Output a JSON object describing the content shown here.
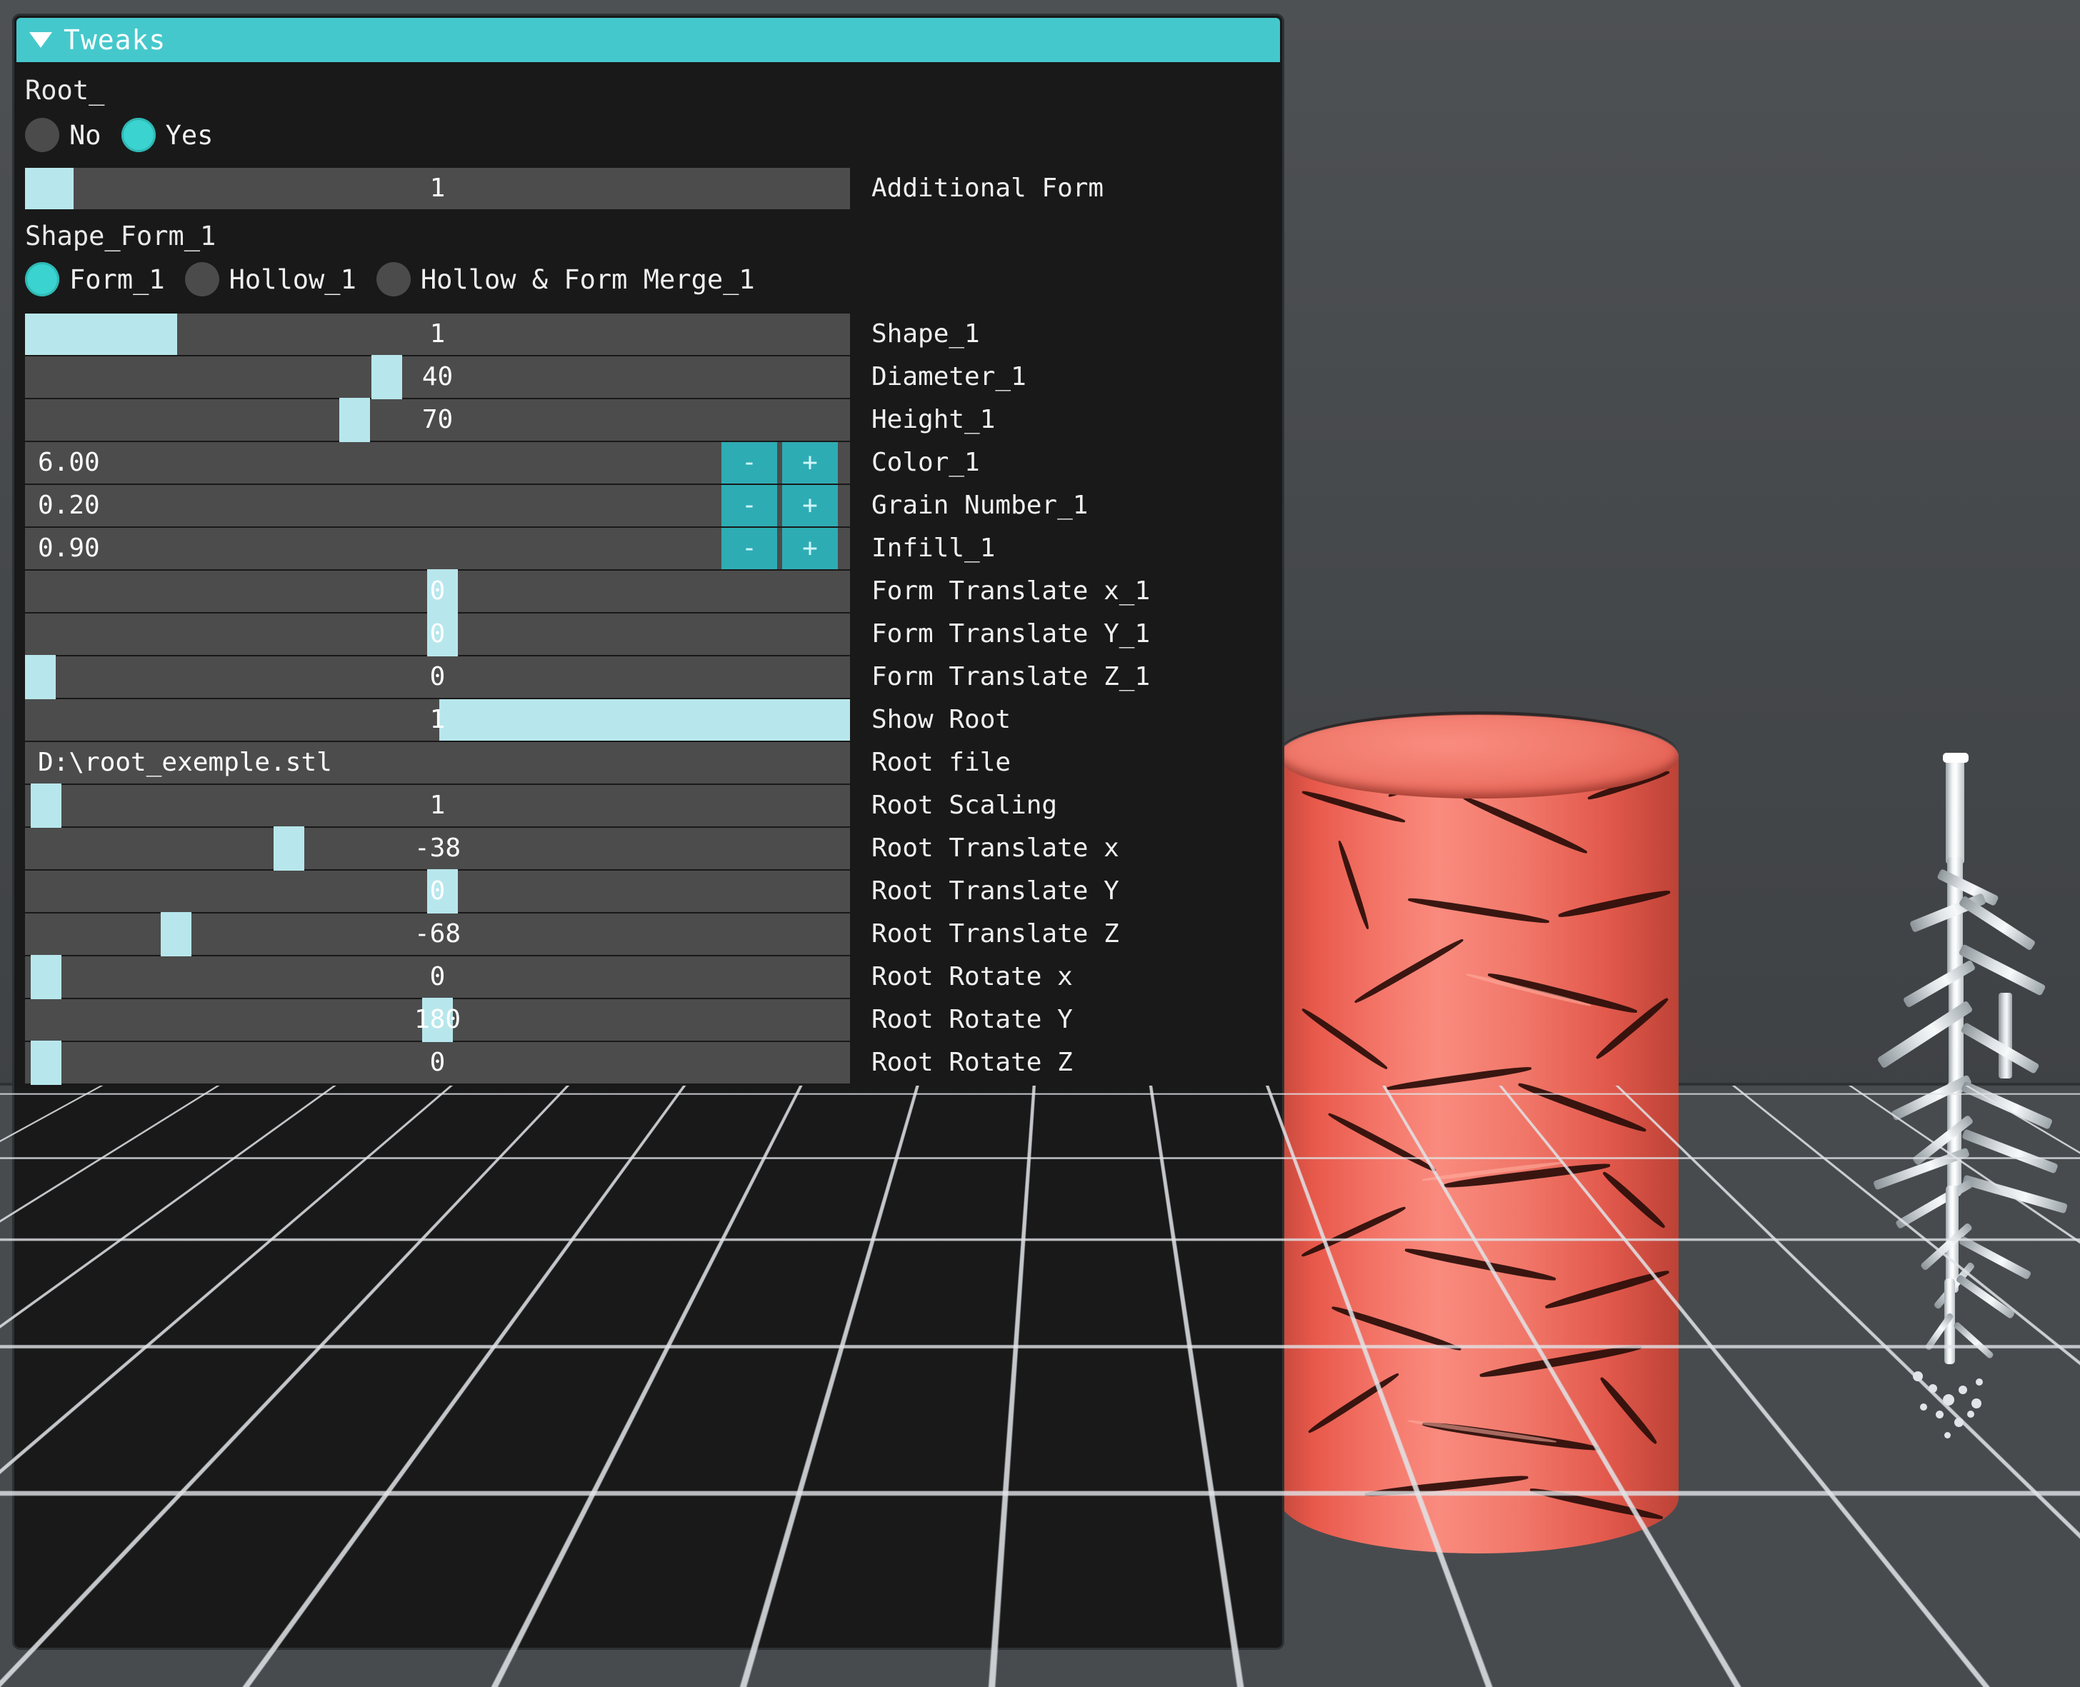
{
  "panel": {
    "title": "Tweaks",
    "collapse_icon": "triangle-down-icon",
    "groups": [
      {
        "label": "Root_"
      },
      {
        "label": "Shape_Form_1"
      }
    ],
    "root_radios": [
      {
        "label": "No",
        "selected": false
      },
      {
        "label": "Yes",
        "selected": true
      }
    ],
    "shape_form_radios": [
      {
        "label": "Form_1",
        "selected": true
      },
      {
        "label": "Hollow_1",
        "selected": false
      },
      {
        "label": "Hollow & Form Merge_1",
        "selected": false
      }
    ],
    "rows": [
      {
        "label": "Additional Form",
        "value": "1",
        "kind": "fill",
        "fill_from": 0,
        "fill_to": 68
      },
      {
        "label": "Shape_1",
        "value": "1",
        "kind": "fill",
        "fill_from": 0,
        "fill_to": 213
      },
      {
        "label": "Diameter_1",
        "value": "40",
        "kind": "handle",
        "handle_at": 485
      },
      {
        "label": "Height_1",
        "value": "70",
        "kind": "handle",
        "handle_at": 440
      },
      {
        "label": "Color_1",
        "value": "6.00",
        "kind": "stepper",
        "minus": "-",
        "plus": "+"
      },
      {
        "label": "Grain Number_1",
        "value": "0.20",
        "kind": "stepper",
        "minus": "-",
        "plus": "+"
      },
      {
        "label": "Infill_1",
        "value": "0.90",
        "kind": "stepper",
        "minus": "-",
        "plus": "+"
      },
      {
        "label": "Form Translate x_1",
        "value": "0",
        "kind": "handle",
        "handle_at": 563
      },
      {
        "label": "Form Translate Y_1",
        "value": "0",
        "kind": "handle",
        "handle_at": 563
      },
      {
        "label": "Form Translate Z_1",
        "value": "0",
        "kind": "handle",
        "handle_at": 0
      },
      {
        "label": "Show Root",
        "value": "1",
        "kind": "fill",
        "fill_from": 580,
        "fill_to": 1155
      },
      {
        "label": "Root file",
        "value": "D:\\root_exemple.stl",
        "kind": "text"
      },
      {
        "label": "Root Scaling",
        "value": "1",
        "kind": "handle",
        "handle_at": 8
      },
      {
        "label": "Root Translate x",
        "value": "-38",
        "kind": "handle",
        "handle_at": 348
      },
      {
        "label": "Root Translate Y",
        "value": "0",
        "kind": "handle",
        "handle_at": 563
      },
      {
        "label": "Root Translate Z",
        "value": "-68",
        "kind": "handle",
        "handle_at": 190
      },
      {
        "label": "Root Rotate x",
        "value": "0",
        "kind": "handle",
        "handle_at": 8
      },
      {
        "label": "Root Rotate Y",
        "value": "180",
        "kind": "handle",
        "handle_at": 556
      },
      {
        "label": "Root Rotate Z",
        "value": "0",
        "kind": "handle",
        "handle_at": 8
      }
    ]
  },
  "viewport": {
    "objects": [
      {
        "name": "form-cylinder",
        "description": "red cracked cylinder"
      },
      {
        "name": "root-model",
        "description": "white branching root model"
      },
      {
        "name": "build-grid",
        "description": "perspective grid floor"
      }
    ]
  },
  "colors": {
    "accent_teal": "#45c8cc",
    "slider_fill": "#b7e7ec",
    "panel_bg": "#191919",
    "track_bg": "#4c4c4c",
    "step_button": "#2eacb4",
    "cylinder_red": "#f0796b",
    "viewport_bg": "#4a4d50"
  }
}
